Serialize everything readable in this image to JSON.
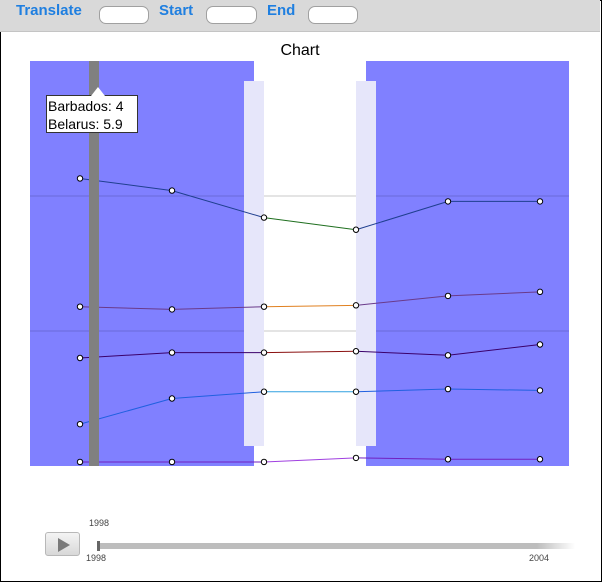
{
  "toolbar": {
    "translate_label": "Translate",
    "start_label": "Start",
    "end_label": "End",
    "translate_value": "",
    "start_value": "",
    "end_value": ""
  },
  "tooltip": {
    "line1": "Barbados: 4",
    "line2": "Belarus: 5.9"
  },
  "slider": {
    "current_label": "1998",
    "min_label": "1998",
    "max_label": "2004",
    "value": 1998
  },
  "icons": {
    "play": "play-icon"
  },
  "colors": {
    "background_band": "#8080ff",
    "focus_band": "#ffffff",
    "selection_bar": "#808080",
    "brush_handle": "#e6e6fa"
  },
  "chart_data": {
    "type": "line",
    "title": "Chart",
    "x": [
      1,
      2,
      3,
      4,
      5,
      6
    ],
    "ylim": [
      0,
      3
    ],
    "grid": true,
    "series": [
      {
        "color": "#1f3f8f",
        "values": [
          2.13,
          2.04,
          1.84,
          1.75,
          1.96,
          1.96
        ],
        "focus_colors": [
          "#1f3f8f",
          "#1f6f1f",
          "#1f3f8f"
        ]
      },
      {
        "color": "#6a3a8a",
        "values": [
          1.18,
          1.16,
          1.18,
          1.19,
          1.26,
          1.29
        ],
        "focus_colors": [
          "#6a3a8a",
          "#e08020",
          "#6a3a8a"
        ]
      },
      {
        "color": "#3a006a",
        "values": [
          0.8,
          0.84,
          0.84,
          0.85,
          0.82,
          0.9
        ],
        "focus_colors": [
          "#3a006a",
          "#8a1010",
          "#3a006a"
        ]
      },
      {
        "color": "#2060e0",
        "values": [
          0.31,
          0.5,
          0.55,
          0.55,
          0.57,
          0.56
        ],
        "focus_colors": [
          "#2060e0",
          "#30a0e0",
          "#2060e0"
        ]
      },
      {
        "color": "#7020c0",
        "values": [
          0.03,
          0.03,
          0.03,
          0.06,
          0.05,
          0.05
        ],
        "focus_colors": [
          "#7020c0",
          "#a040e0",
          "#7020c0"
        ]
      }
    ]
  }
}
